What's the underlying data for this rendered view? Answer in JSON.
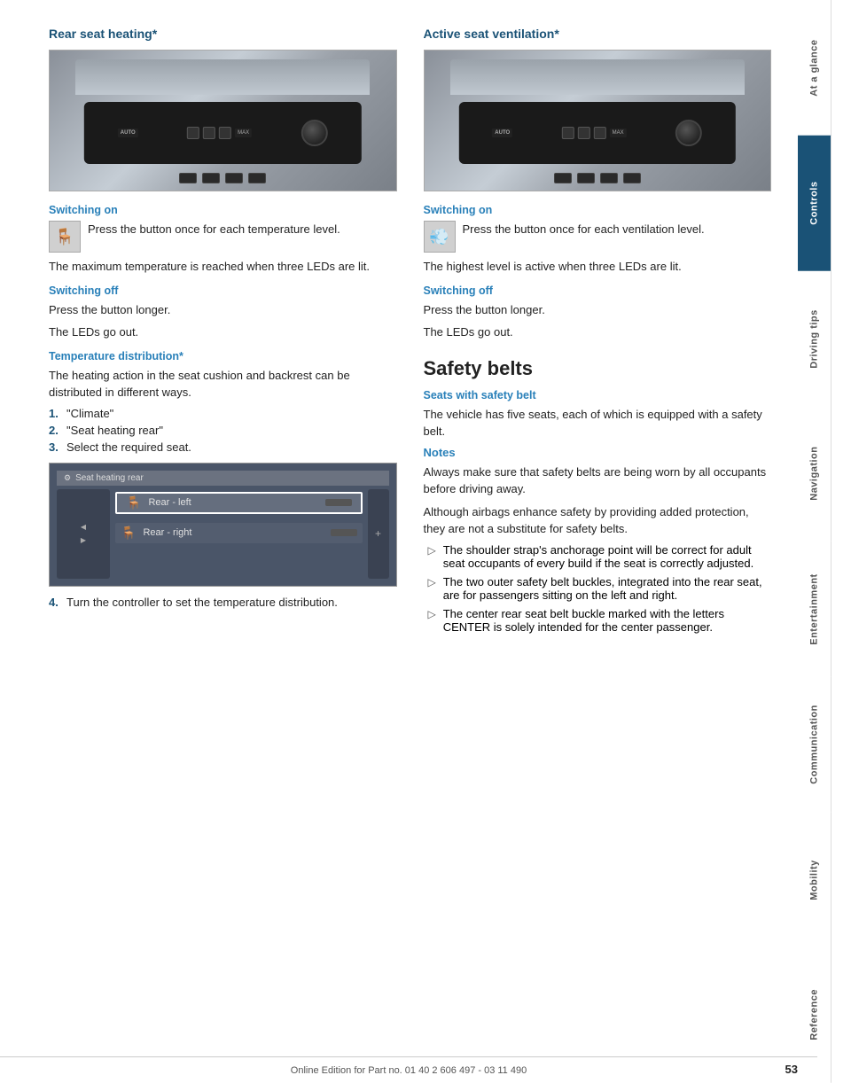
{
  "page": {
    "number": "53",
    "footer": "Online Edition for Part no. 01 40 2 606 497 - 03 11 490"
  },
  "sidebar": {
    "items": [
      {
        "label": "At a glance",
        "active": false
      },
      {
        "label": "Controls",
        "active": true
      },
      {
        "label": "Driving tips",
        "active": false
      },
      {
        "label": "Navigation",
        "active": false
      },
      {
        "label": "Entertainment",
        "active": false
      },
      {
        "label": "Communication",
        "active": false
      },
      {
        "label": "Mobility",
        "active": false
      },
      {
        "label": "Reference",
        "active": false
      }
    ]
  },
  "left_section": {
    "title": "Rear seat heating*",
    "switching_on_label": "Switching on",
    "switching_on_text": "Press the button once for each temperature level.",
    "max_temp_text": "The maximum temperature is reached when three LEDs are lit.",
    "switching_off_label": "Switching off",
    "switching_off_text1": "Press the button longer.",
    "switching_off_text2": "The LEDs go out.",
    "temp_dist_label": "Temperature distribution*",
    "temp_dist_text": "The heating action in the seat cushion and backrest can be distributed in different ways.",
    "list_items": [
      {
        "num": "1.",
        "text": "\"Climate\""
      },
      {
        "num": "2.",
        "text": "\"Seat heating rear\""
      },
      {
        "num": "3.",
        "text": "Select the required seat."
      }
    ],
    "screen_header": "Seat heating rear",
    "screen_row1": "Rear - left",
    "screen_row2": "Rear - right",
    "step4_text": "Turn the controller to set the temperature distribution."
  },
  "right_section": {
    "title": "Active seat ventilation*",
    "switching_on_label": "Switching on",
    "switching_on_text": "Press the button once for each ventilation level.",
    "highest_level_text": "The highest level is active when three LEDs are lit.",
    "switching_off_label": "Switching off",
    "switching_off_text1": "Press the button longer.",
    "switching_off_text2": "The LEDs go out.",
    "safety_title": "Safety belts",
    "seats_subtitle": "Seats with safety belt",
    "seats_text": "The vehicle has five seats, each of which is equipped with a safety belt.",
    "notes_label": "Notes",
    "notes_text1": "Always make sure that safety belts are being worn by all occupants before driving away.",
    "notes_text2": "Although airbags enhance safety by providing added protection, they are not a substitute for safety belts.",
    "bullets": [
      "The shoulder strap's anchorage point will be correct for adult seat occupants of every build if the seat is correctly adjusted.",
      "The two outer safety belt buckles, integrated into the rear seat, are for passengers sitting on the left and right.",
      "The center rear seat belt buckle marked with the letters CENTER is solely intended for the center passenger."
    ]
  }
}
